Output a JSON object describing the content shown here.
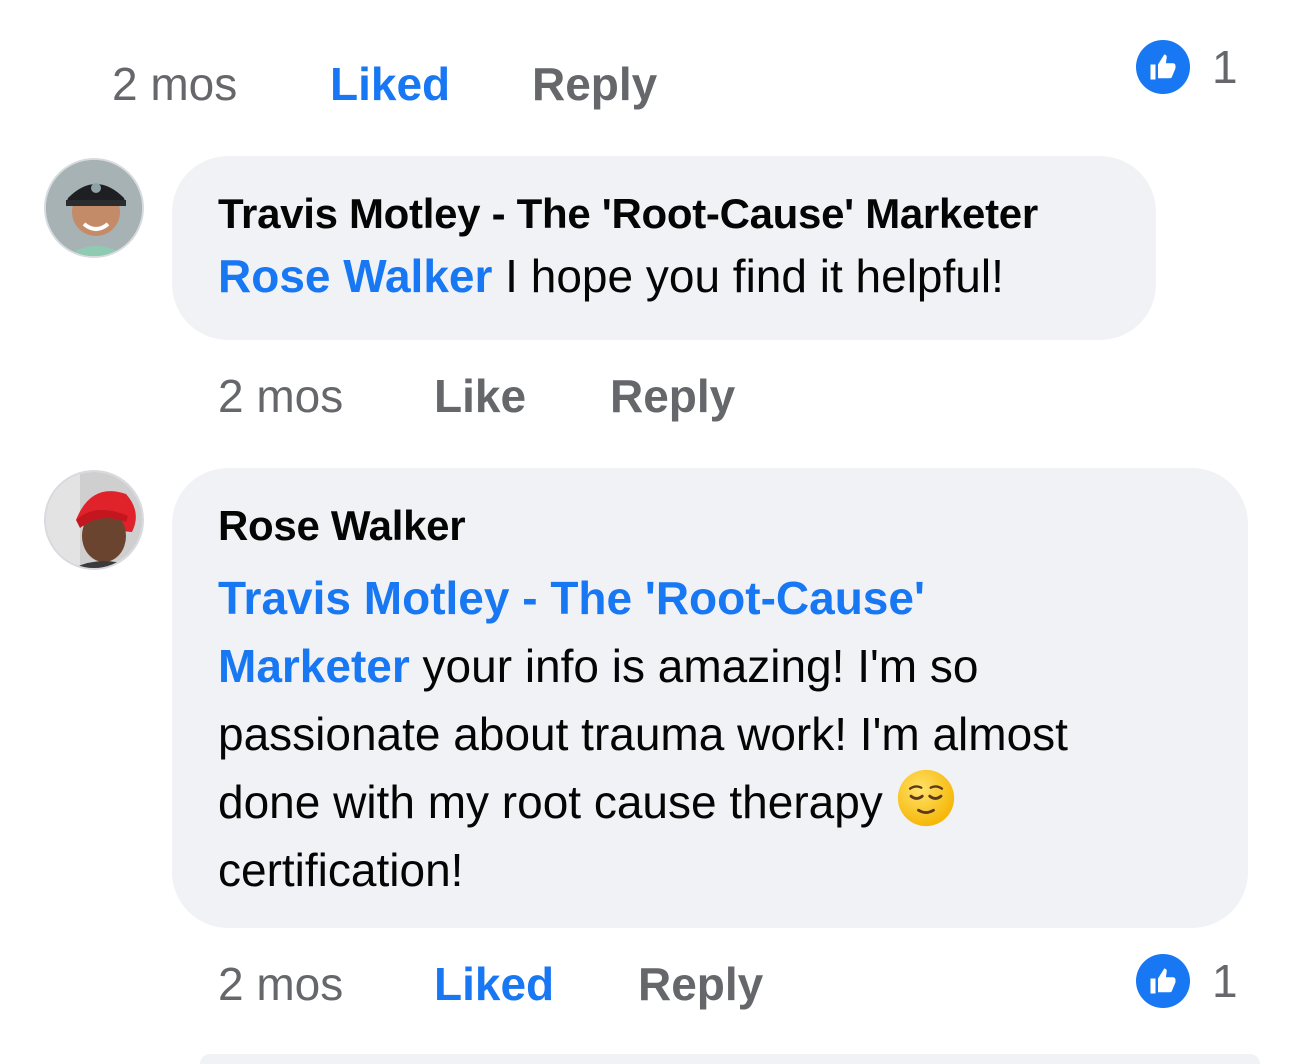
{
  "top_actions": {
    "time": "2 mos",
    "like_label": "Liked",
    "reply_label": "Reply",
    "reaction_count": "1",
    "reaction_icon": "thumbs-up-icon"
  },
  "comment_travis": {
    "author": "Travis Motley - The 'Root-Cause' Marketer",
    "mention": "Rose Walker",
    "text": " I hope you find it helpful!",
    "time": "2 mos",
    "like_label": "Like",
    "reply_label": "Reply"
  },
  "comment_rose": {
    "author": "Rose Walker",
    "mention_line1": "Travis Motley - The 'Root-Cause'",
    "mention_line2": "Marketer",
    "text_line2": " your info is amazing! I'm so",
    "text_line3": "passionate about trauma work! I'm almost",
    "text_line4": "done with my root cause therapy ",
    "emoji": "relieved-face-emoji",
    "text_line5": "certification!",
    "time": "2 mos",
    "like_label": "Liked",
    "reply_label": "Reply",
    "reaction_count": "1",
    "reaction_icon": "thumbs-up-icon"
  },
  "colors": {
    "accent": "#1877f2",
    "bubble": "#f0f2f5",
    "muted": "#65676b",
    "text": "#050505"
  }
}
